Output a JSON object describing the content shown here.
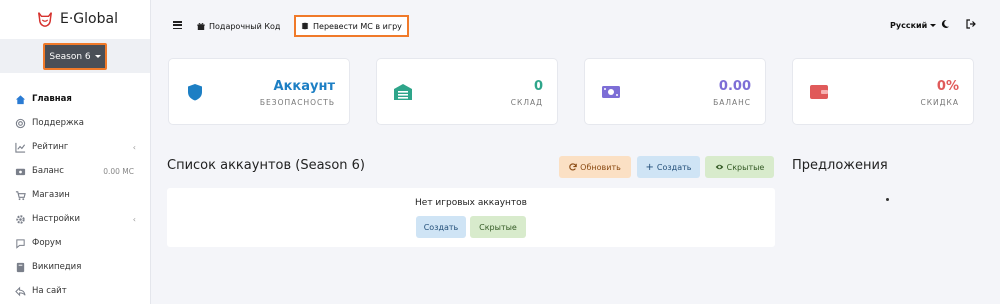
{
  "brand": {
    "name": "E·Global"
  },
  "sidebar": {
    "season_label": "Season 6",
    "items": [
      {
        "label": "Главная",
        "icon": "home-icon",
        "active": true
      },
      {
        "label": "Поддержка",
        "icon": "support-icon"
      },
      {
        "label": "Рейтинг",
        "icon": "chart-icon",
        "chevron": "‹"
      },
      {
        "label": "Баланс",
        "icon": "wallet-icon",
        "value": "0.00 MC"
      },
      {
        "label": "Магазин",
        "icon": "cart-icon"
      },
      {
        "label": "Настройки",
        "icon": "gear-icon",
        "chevron": "‹"
      },
      {
        "label": "Форум",
        "icon": "chat-icon"
      },
      {
        "label": "Википедия",
        "icon": "book-icon"
      },
      {
        "label": "На сайт",
        "icon": "reply-icon"
      }
    ]
  },
  "topbar": {
    "gift_label": "Подарочный Код",
    "transfer_label": "Перевести МС в игру",
    "language": "Русский"
  },
  "stats": [
    {
      "value": "Аккаунт",
      "label": "БЕЗОПАСНОСТЬ",
      "icon": "shield-icon",
      "color": "#1d7fc4"
    },
    {
      "value": "0",
      "label": "СКЛАД",
      "icon": "warehouse-icon",
      "color": "#2ea58a"
    },
    {
      "value": "0.00",
      "label": "БАЛАНС",
      "icon": "money-icon",
      "color": "#7d6ed6"
    },
    {
      "value": "0%",
      "label": "СКИДКА",
      "icon": "wallet-icon",
      "color": "#e05a5a"
    }
  ],
  "accounts": {
    "title": "Список аккаунтов (Season 6)",
    "refresh_label": "Обновить",
    "create_label": "Создать",
    "hidden_label": "Скрытые",
    "empty_text": "Нет игровых аккаунтов",
    "panel_create_label": "Создать",
    "panel_hidden_label": "Скрытые"
  },
  "offers": {
    "title": "Предложения"
  }
}
